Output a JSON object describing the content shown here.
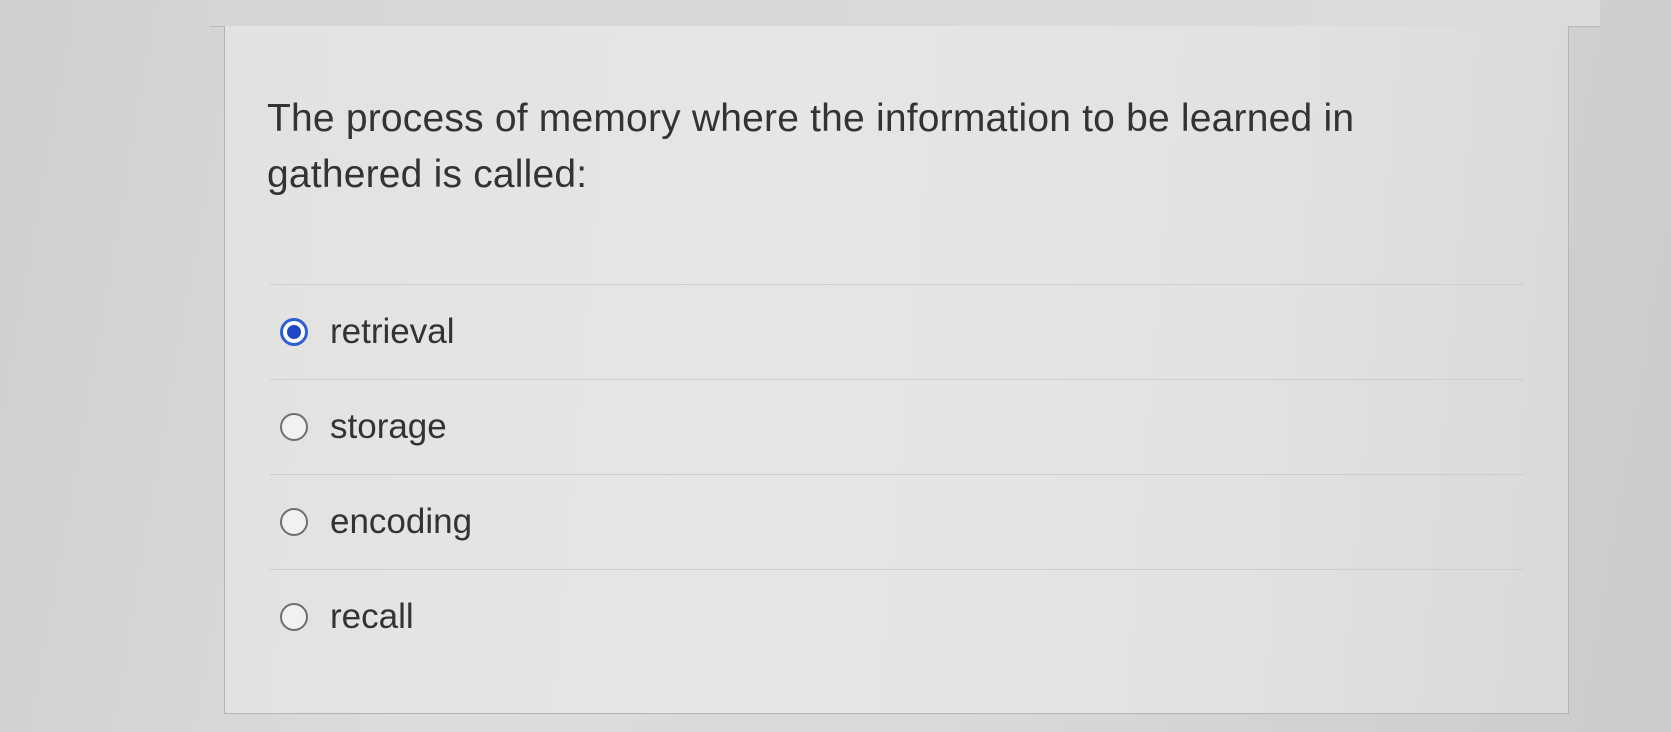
{
  "question": {
    "text": "The process of memory where the information to be learned in gathered is called:"
  },
  "answers": [
    {
      "label": "retrieval",
      "selected": true
    },
    {
      "label": "storage",
      "selected": false
    },
    {
      "label": "encoding",
      "selected": false
    },
    {
      "label": "recall",
      "selected": false
    }
  ],
  "colors": {
    "selected_radio": "#1d47c4",
    "text": "#333333",
    "background": "#e2e2e0"
  }
}
